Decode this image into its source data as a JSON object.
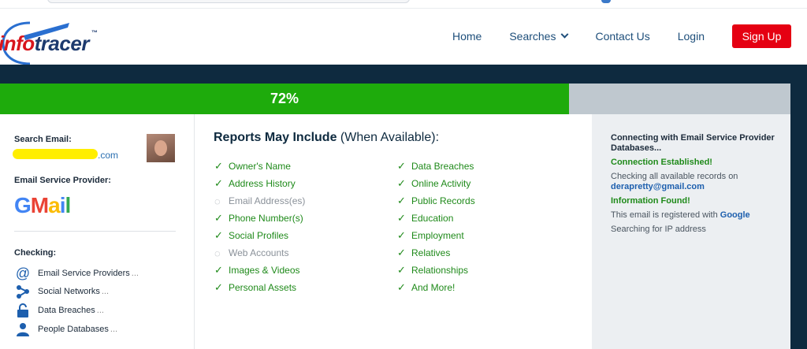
{
  "header": {
    "logo": {
      "part1": "info",
      "part2": "tracer",
      "tm": "™"
    },
    "nav": {
      "home": "Home",
      "searches": "Searches",
      "contact": "Contact Us",
      "login": "Login",
      "signup": "Sign Up"
    }
  },
  "progress": {
    "percent_label": "72%",
    "value": 0.72
  },
  "left": {
    "search_email_label": "Search Email:",
    "search_email_domain": ".com",
    "esp_label": "Email Service Provider:",
    "esp_logo": {
      "g": "G",
      "m": "M",
      "a": "a",
      "i": "i",
      "l": "l"
    },
    "checking_label": "Checking:",
    "checking_items": [
      {
        "label": "Email Service Providers",
        "icon": "at-icon",
        "suffix": " ..."
      },
      {
        "label": "Social Networks",
        "icon": "share-icon",
        "suffix": " ..."
      },
      {
        "label": "Data Breaches",
        "icon": "unlock-icon",
        "suffix": " ..."
      },
      {
        "label": "People Databases",
        "icon": "person-icon",
        "suffix": " ..."
      }
    ]
  },
  "reports": {
    "title_bold": "Reports May Include",
    "title_rest": " (When Available):",
    "col1": [
      {
        "label": "Owner's Name",
        "checked": true
      },
      {
        "label": "Address History",
        "checked": true
      },
      {
        "label": "Email Address(es)",
        "checked": false
      },
      {
        "label": "Phone Number(s)",
        "checked": true
      },
      {
        "label": "Social Profiles",
        "checked": true
      },
      {
        "label": "Web Accounts",
        "checked": false
      },
      {
        "label": "Images & Videos",
        "checked": true
      },
      {
        "label": "Personal Assets",
        "checked": true
      }
    ],
    "col2": [
      {
        "label": "Data Breaches",
        "checked": true
      },
      {
        "label": "Online Activity",
        "checked": true
      },
      {
        "label": "Public Records",
        "checked": true
      },
      {
        "label": "Education",
        "checked": true
      },
      {
        "label": "Employment",
        "checked": true
      },
      {
        "label": "Relatives",
        "checked": true
      },
      {
        "label": "Relationships",
        "checked": true
      },
      {
        "label": "And More!",
        "checked": true
      }
    ],
    "check_glyph": "✓",
    "pending_glyph": "◌"
  },
  "status": {
    "connecting": "Connecting with Email Service Provider Databases...",
    "established": "Connection Established!",
    "checking_prefix": "Checking all available records on",
    "email": "derapretty@gmail.com",
    "found": "Information Found!",
    "registered_prefix": "This email is registered with ",
    "registered_with": "Google",
    "searching_ip": "Searching for IP address"
  },
  "colors": {
    "accent_green": "#1eab0c",
    "brand_red": "#e50012",
    "dark_band": "#0e2a3f",
    "link_blue": "#1d5fae"
  }
}
